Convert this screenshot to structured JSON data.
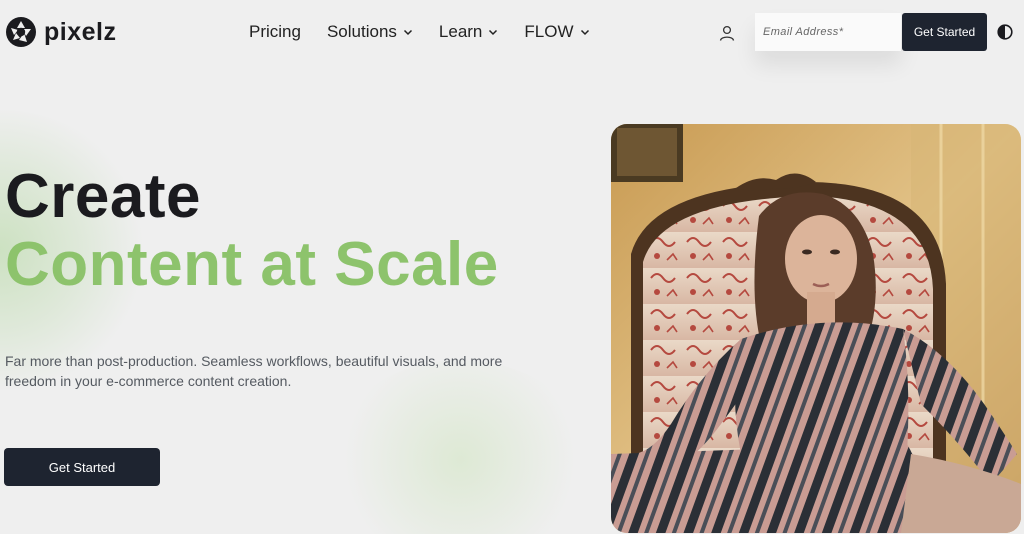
{
  "brand": {
    "name": "pixelz"
  },
  "nav": {
    "items": [
      {
        "label": "Pricing",
        "has_dropdown": false
      },
      {
        "label": "Solutions",
        "has_dropdown": true
      },
      {
        "label": "Learn",
        "has_dropdown": true
      },
      {
        "label": "FLOW",
        "has_dropdown": true
      }
    ]
  },
  "header": {
    "account_icon": "user-icon",
    "email_placeholder": "Email Address*",
    "cta_label": "Get Started",
    "theme_icon": "contrast-icon"
  },
  "hero": {
    "title_line1": "Create",
    "title_line2": "Content at Scale",
    "description": "Far more than post-production. Seamless workflows, beautiful visuals, and more freedom in your e-commerce content creation.",
    "cta_label": "Get Started"
  },
  "colors": {
    "accent_green": "#8dc36c",
    "dark_button": "#1e2430",
    "background": "#efefef"
  }
}
